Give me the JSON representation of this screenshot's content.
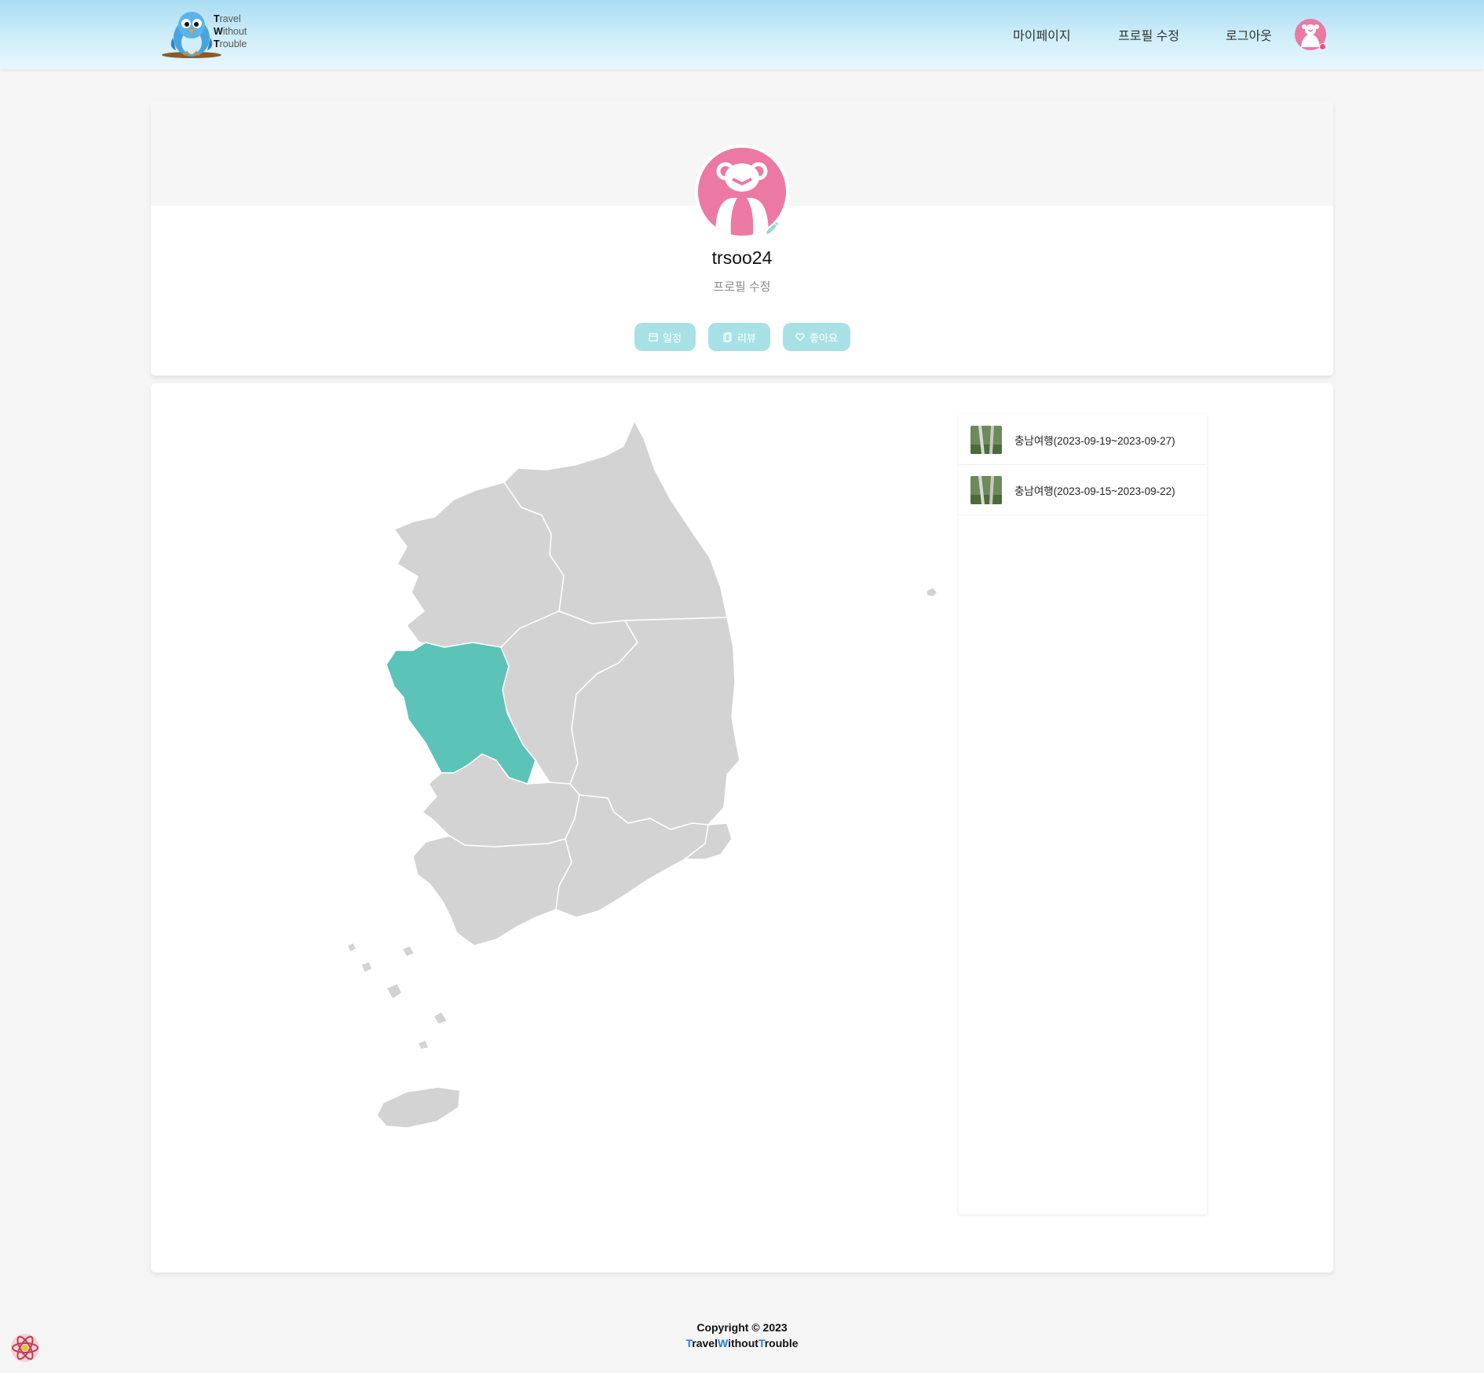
{
  "header": {
    "logo": {
      "line1_initial": "T",
      "line1_rest": "ravel",
      "line2_initial": "W",
      "line2_rest": "ithout",
      "line3_initial": "T",
      "line3_rest": "rouble"
    },
    "nav": {
      "mypage": "마이페이지",
      "edit_profile": "프로필 수정",
      "logout": "로그아웃"
    }
  },
  "profile": {
    "username": "trsoo24",
    "edit_link": "프로필 수정",
    "buttons": {
      "schedule": "일정",
      "review": "리뷰",
      "like": "좋아요"
    }
  },
  "map": {
    "highlight_color": "#5bc3b8",
    "base_color": "#d3d3d3",
    "visited_regions": [
      "충청남도"
    ]
  },
  "trips": [
    {
      "label": "충남여행(2023-09-19~2023-09-27)"
    },
    {
      "label": "충남여행(2023-09-15~2023-09-22)"
    }
  ],
  "footer": {
    "copyright": "Copyright © 2023",
    "brand_parts": [
      "T",
      "ravel",
      "W",
      "ithout",
      "T",
      "rouble"
    ]
  },
  "colors": {
    "accent": "#a8e1e5",
    "avatar_pink": "#ec78a4",
    "brand_blue": "#1e7dfa"
  }
}
